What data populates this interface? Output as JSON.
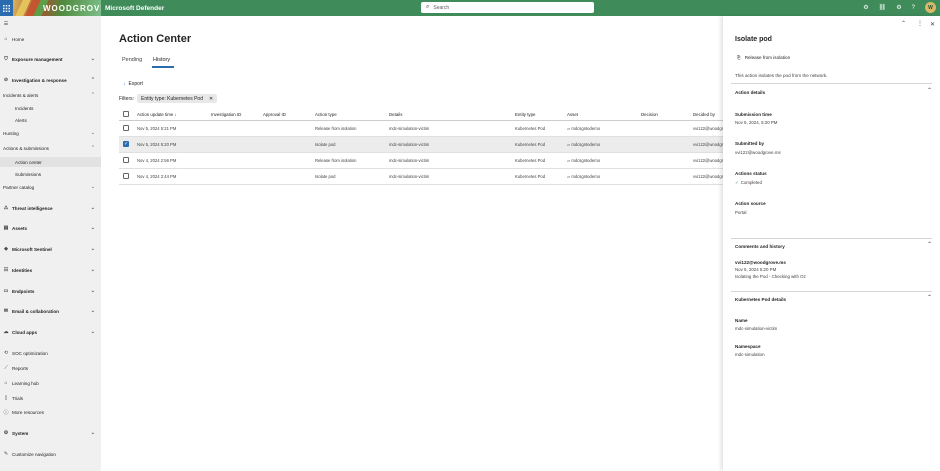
{
  "topbar": {
    "brand": "WOODGROVE",
    "product": "Microsoft Defender",
    "search_placeholder": "Search",
    "avatar_initials": "W",
    "bg_color": "#3f8c5a"
  },
  "nav": {
    "items": [
      {
        "label": "Home",
        "icon": "home-icon",
        "style": "icon"
      },
      {
        "label": "Exposure management",
        "icon": "shield-icon",
        "style": "bold",
        "chevron": "⌄"
      },
      {
        "label": "Investigation & response",
        "icon": "investigation-icon",
        "style": "bold",
        "chevron": "⌃"
      },
      {
        "label": "Incidents & alerts",
        "style": "plain",
        "chevron": "⌃"
      },
      {
        "label": "Incidents",
        "style": "sub"
      },
      {
        "label": "Alerts",
        "style": "sub"
      },
      {
        "label": "Hunting",
        "style": "plain",
        "chevron": "⌄"
      },
      {
        "label": "Actions & submissions",
        "style": "plain",
        "chevron": "⌃"
      },
      {
        "label": "Action center",
        "style": "sub",
        "active": true
      },
      {
        "label": "Submissions",
        "style": "sub"
      },
      {
        "label": "Partner catalog",
        "style": "plain",
        "chevron": "⌄"
      },
      {
        "label": "Threat intelligence",
        "icon": "threat-intel-icon",
        "style": "bold",
        "chevron": "⌄"
      },
      {
        "label": "Assets",
        "icon": "assets-icon",
        "style": "bold",
        "chevron": "⌄"
      },
      {
        "label": "Microsoft Sentinel",
        "icon": "sentinel-icon",
        "style": "bold",
        "chevron": "⌄"
      },
      {
        "label": "Identities",
        "icon": "identities-icon",
        "style": "bold",
        "chevron": "⌄"
      },
      {
        "label": "Endpoints",
        "icon": "endpoints-icon",
        "style": "bold",
        "chevron": "⌄"
      },
      {
        "label": "Email & collaboration",
        "icon": "email-icon",
        "style": "bold",
        "chevron": "⌄"
      },
      {
        "label": "Cloud apps",
        "icon": "cloud-apps-icon",
        "style": "bold",
        "chevron": "⌄"
      },
      {
        "label": "SOC optimization",
        "icon": "soc-icon",
        "style": "icon"
      },
      {
        "label": "Reports",
        "icon": "reports-icon",
        "style": "icon"
      },
      {
        "label": "Learning hub",
        "icon": "learning-icon",
        "style": "icon"
      },
      {
        "label": "Trials",
        "icon": "trials-icon",
        "style": "icon"
      },
      {
        "label": "More resources",
        "icon": "more-resources-icon",
        "style": "icon"
      },
      {
        "label": "System",
        "icon": "system-icon",
        "style": "bold",
        "chevron": "⌄"
      },
      {
        "label": "Customize navigation",
        "icon": "edit-icon",
        "style": "icon"
      }
    ]
  },
  "main": {
    "title": "Action Center",
    "tabs": [
      "Pending",
      "History"
    ],
    "export_label": "Export",
    "filters_label": "Filters:",
    "filter_chip": "Entity type: Kubernetes Pod",
    "columns": [
      "Action update time ↓",
      "Investigation ID",
      "Approval ID",
      "Action type",
      "Details",
      "Entity type",
      "Asset",
      "Decision",
      "Decided by"
    ],
    "rows": [
      {
        "time": "Nov 5, 2024 5:21 PM",
        "investigation_id": "",
        "approval_id": "",
        "action_type": "Release from isolation",
        "details": "mdc-simulation-victim",
        "entity_type": "Kubernetes Pod",
        "asset": "mdcsgntedemo",
        "decision": "",
        "decided_by": "vvi122@woodgr",
        "selected": false
      },
      {
        "time": "Nov 5, 2024 5:20 PM",
        "investigation_id": "",
        "approval_id": "",
        "action_type": "Isolate pod",
        "details": "mdc-simulation-victim",
        "entity_type": "Kubernetes Pod",
        "asset": "mdcsgntedemo",
        "decision": "",
        "decided_by": "vvi122@woodgr",
        "selected": true
      },
      {
        "time": "Nov 4, 2024 2:56 PM",
        "investigation_id": "",
        "approval_id": "",
        "action_type": "Release from isolation",
        "details": "mdc-simulation-victim",
        "entity_type": "Kubernetes Pod",
        "asset": "mdcsgntedemo",
        "decision": "",
        "decided_by": "vvi122@woodgr",
        "selected": false
      },
      {
        "time": "Nov 4, 2024 2:44 PM",
        "investigation_id": "",
        "approval_id": "",
        "action_type": "Isolate pod",
        "details": "mdc-simulation-victim",
        "entity_type": "Kubernetes Pod",
        "asset": "mdcsgntedemo",
        "decision": "",
        "decided_by": "vvi122@woodgr",
        "selected": false
      }
    ]
  },
  "panel": {
    "title": "Isolate pod",
    "release_label": "Release from isolation",
    "description": "This action isolates the pod from the network.",
    "action_details_header": "Action details",
    "submission_time_label": "Submission time",
    "submission_time_value": "Nov 5, 2024, 5:20 PM",
    "submitted_by_label": "Submitted by",
    "submitted_by_value": "vvi122@woodgrove.ms",
    "actions_status_label": "Actions status",
    "actions_status_value": "Completed",
    "action_source_label": "Action source",
    "action_source_value": "Portal",
    "comments_header": "Comments and history",
    "comment_author": "vvi122@woodgrove.ms",
    "comment_time": "Nov 5, 2024 5:20 PM",
    "comment_text": "Isolating the Pod - Checking with Oz",
    "k8s_header": "Kubernetes Pod details",
    "name_label": "Name",
    "name_value": "mdc-simulation-victim",
    "namespace_label": "Namespace",
    "namespace_value": "mdc-simulation"
  }
}
